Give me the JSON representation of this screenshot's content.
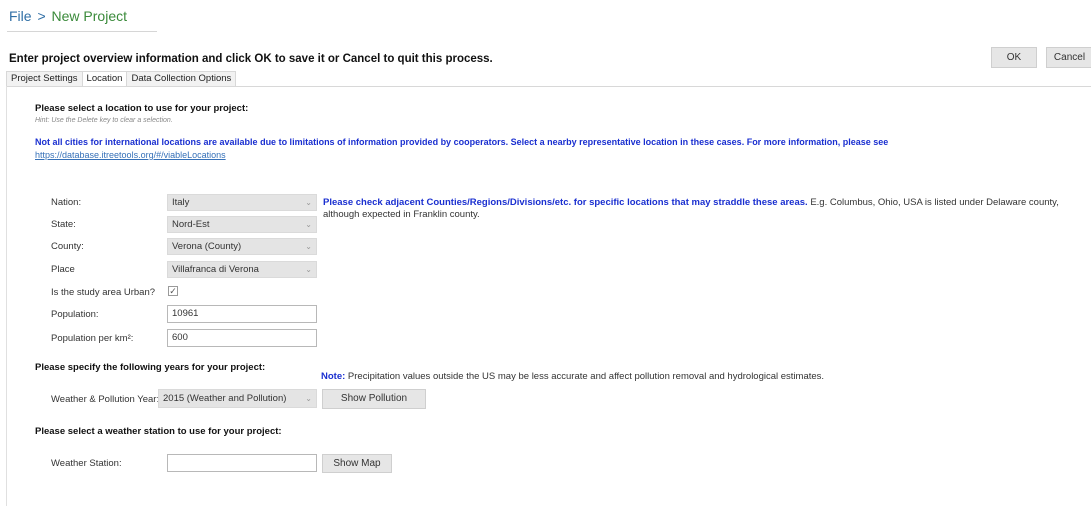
{
  "breadcrumb": {
    "file": "File",
    "separator": ">",
    "current": "New Project"
  },
  "instructions": "Enter project overview information and click OK to save it or Cancel to quit this process.",
  "buttons": {
    "ok": "OK",
    "cancel": "Cancel",
    "show_pollution": "Show Pollution",
    "show_map": "Show Map"
  },
  "tabs": [
    {
      "label": "Project Settings",
      "active": false
    },
    {
      "label": "Location",
      "active": true
    },
    {
      "label": "Data Collection Options",
      "active": false
    }
  ],
  "location": {
    "heading": "Please select a location to use for your project:",
    "hint": "Hint: Use the Delete key to clear a selection.",
    "notice": "Not all cities for international locations are available due to limitations of information provided by cooperators. Select a nearby representative location in these cases. For more information, please see",
    "notice_link": "https://database.itreetools.org/#/viableLocations",
    "nation_label": "Nation:",
    "nation_value": "Italy",
    "state_label": "State:",
    "state_value": "Nord-Est",
    "county_label": "County:",
    "county_value": "Verona (County)",
    "place_label": "Place",
    "place_value": "Villafranca di Verona",
    "urban_label": "Is the study area Urban?",
    "urban_checked": true,
    "population_label": "Population:",
    "population_value": "10961",
    "density_label": "Population per km²:",
    "density_value": "600",
    "straddle_bold": "Please check adjacent Counties/Regions/Divisions/etc. for specific locations that may straddle these areas.",
    "straddle_text": "E.g. Columbus, Ohio, USA is listed under Delaware county, although expected in Franklin county."
  },
  "years": {
    "heading": "Please specify the following years for your project:",
    "note_bold": "Note:",
    "note_text": "Precipitation values outside the US may be less accurate and affect pollution removal and hydrological estimates.",
    "weather_year_label": "Weather & Pollution Year:",
    "weather_year_value": "2015 (Weather and Pollution)"
  },
  "station": {
    "heading": "Please select a weather station to use for your project:",
    "label": "Weather Station:",
    "value": ""
  },
  "icons": {
    "caret": "⌄",
    "check": "✓"
  },
  "colors": {
    "accent_blue": "#1a2fd0",
    "link_blue": "#3570b8",
    "breadcrumb_green": "#3a8a3a"
  }
}
